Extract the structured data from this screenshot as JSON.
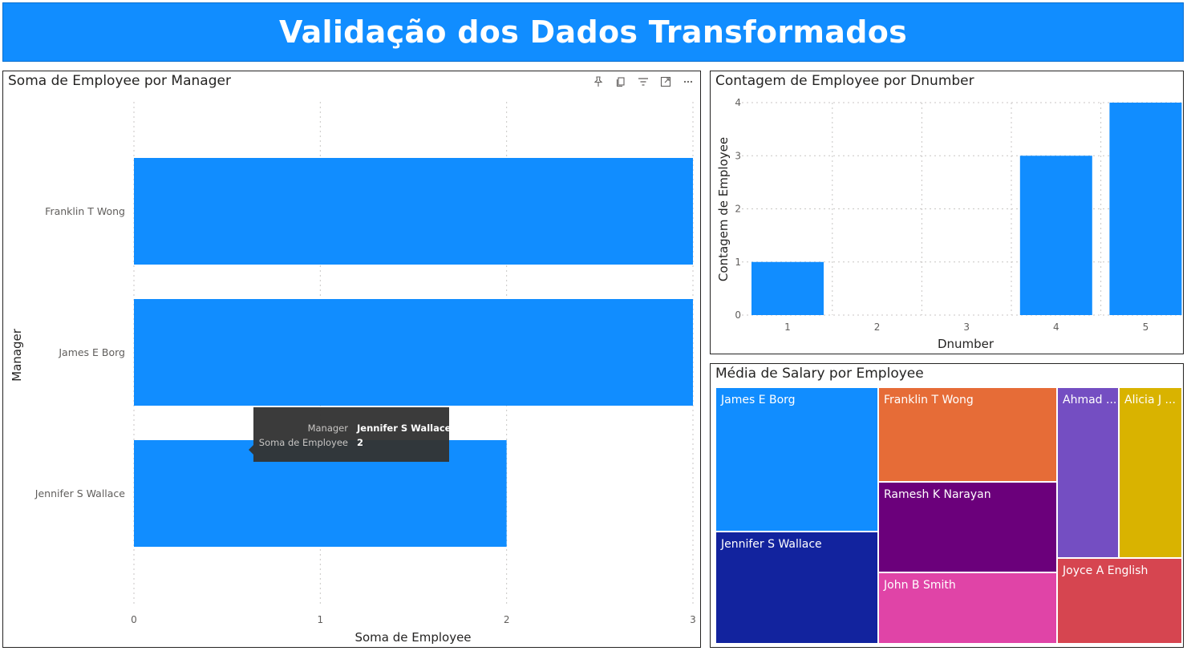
{
  "header": {
    "title": "Validação dos Dados Transformados",
    "background": "#118DFF"
  },
  "visual_header_icons": [
    "pin-icon",
    "copy-icon",
    "filter-icon",
    "focus-mode-icon",
    "more-options-icon"
  ],
  "charts": {
    "manager": {
      "title": "Soma de Employee por Manager",
      "xlabel": "Soma de Employee",
      "ylabel": "Manager",
      "ticks": [
        "0",
        "1",
        "2",
        "3"
      ],
      "tooltip": {
        "label1": "Manager",
        "value1": "Jennifer S Wallace",
        "label2": "Soma de Employee",
        "value2": "2"
      }
    },
    "dnumber": {
      "title": "Contagem de Employee por Dnumber",
      "xlabel": "Dnumber",
      "ylabel": "Contagem de Employee",
      "yticks": [
        "0",
        "1",
        "2",
        "3",
        "4"
      ]
    },
    "salary": {
      "title": "Média de Salary por Employee"
    }
  },
  "chart_data": [
    {
      "type": "bar",
      "orientation": "horizontal",
      "title": "Soma de Employee por Manager",
      "xlabel": "Soma de Employee",
      "ylabel": "Manager",
      "categories": [
        "Franklin T Wong",
        "James E Borg",
        "Jennifer S Wallace"
      ],
      "values": [
        3,
        3,
        2
      ],
      "xlim": [
        0,
        3
      ],
      "grid": true,
      "color": "#118DFF"
    },
    {
      "type": "bar",
      "title": "Contagem de Employee por Dnumber",
      "xlabel": "Dnumber",
      "ylabel": "Contagem de Employee",
      "categories": [
        "1",
        "2",
        "3",
        "4",
        "5"
      ],
      "values": [
        1,
        0,
        0,
        3,
        4
      ],
      "ylim": [
        0,
        4
      ],
      "grid": true,
      "color": "#118DFF"
    },
    {
      "type": "treemap",
      "title": "Média de Salary por Employee",
      "categories": [
        "James E Borg",
        "Jennifer S Wallace",
        "Franklin T Wong",
        "Ramesh K Narayan",
        "John B Smith",
        "Ahmad ...",
        "Alicia J ...",
        "Joyce A English"
      ],
      "colors": [
        "#118DFF",
        "#12239E",
        "#E66C37",
        "#6B007B",
        "#E044A7",
        "#744EC2",
        "#D9B300",
        "#D64550"
      ]
    }
  ]
}
